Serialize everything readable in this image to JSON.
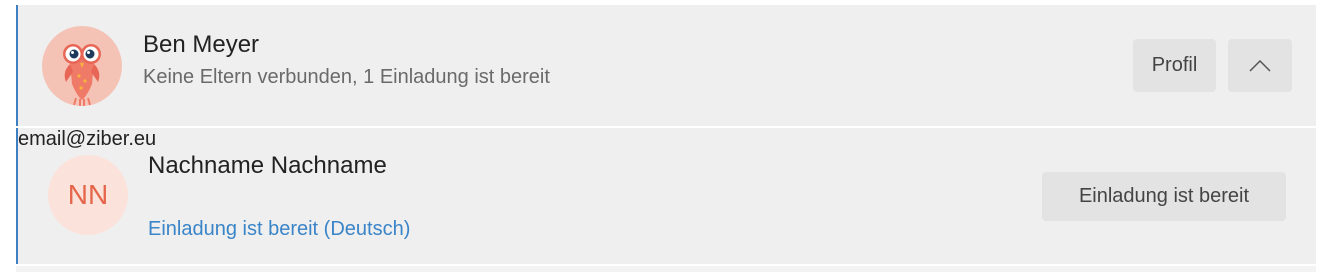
{
  "student": {
    "name": "Ben Meyer",
    "status": "Keine Eltern verbunden, 1 Einladung ist bereit",
    "profile_label": "Profil",
    "avatar_icon": "owl-mascot-icon",
    "collapse_icon": "chevron-up-icon"
  },
  "parent": {
    "initials": "NN",
    "name": "Nachname Nachname",
    "email": "email@ziber.eu",
    "invite_link": "Einladung ist bereit (Deutsch)",
    "invite_button_label": "Einladung ist bereit"
  },
  "colors": {
    "accent_blue": "#3d7fc1",
    "link_blue": "#3a84c8",
    "panel_bg": "#efefef",
    "initials_orange": "#e5664a"
  }
}
